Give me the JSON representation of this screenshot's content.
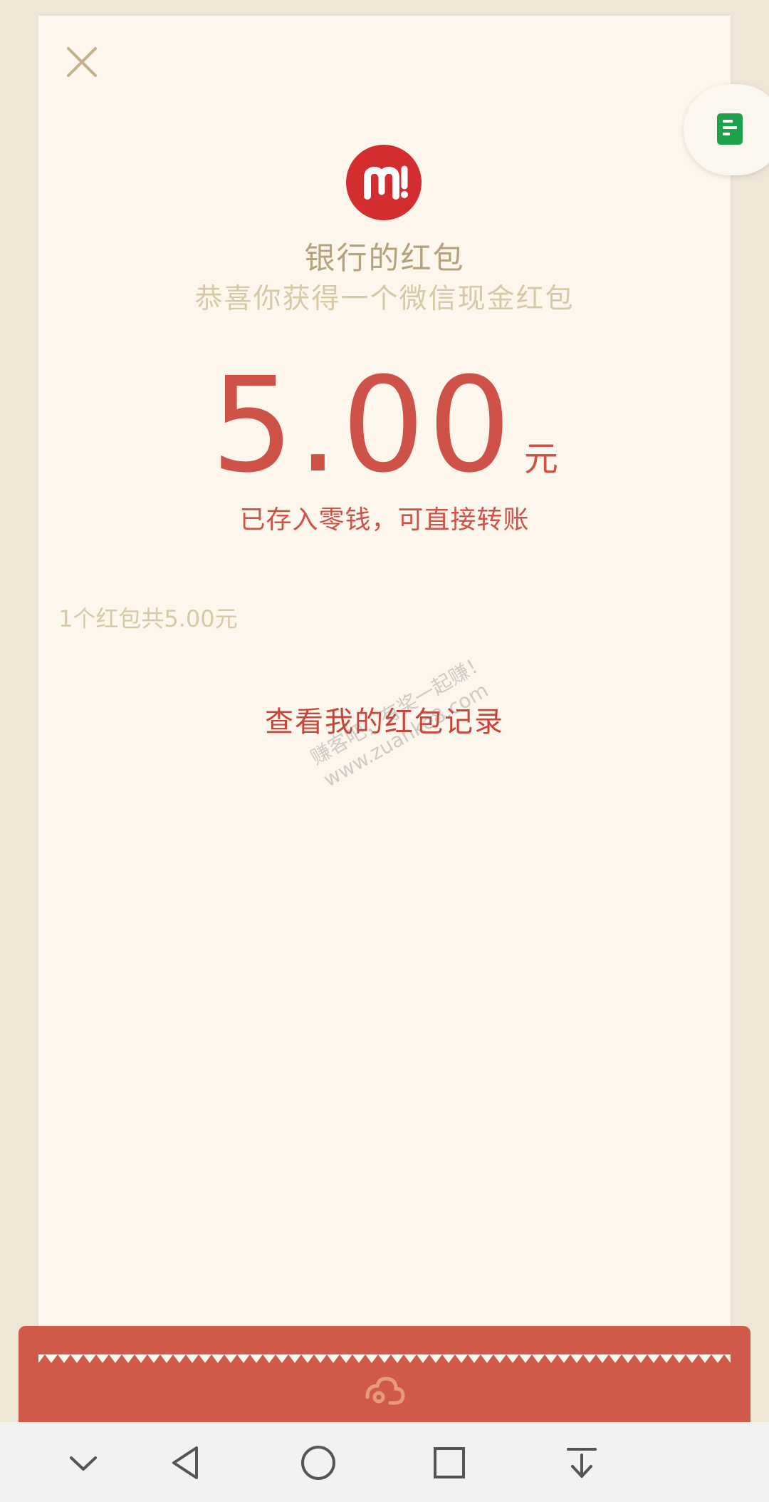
{
  "header": {
    "close_icon": "close-icon",
    "side_icon": "document-icon"
  },
  "sender": {
    "logo_icon": "bank-logo-icon",
    "name": "银行的红包",
    "greeting": "恭喜你获得一个微信现金红包"
  },
  "amount": {
    "value": "5.00",
    "unit": "元",
    "status": "已存入零钱，可直接转账"
  },
  "summary": "1个红包共5.00元",
  "record_link": "查看我的红包记录",
  "watermark": {
    "line1": "赚客吧，有奖一起赚！",
    "line2": "www.zuanke8.com"
  },
  "bottom_band_icon": "cloud-icon",
  "navbar": {
    "icons": [
      "chevron-down-icon",
      "back-icon",
      "home-icon",
      "recents-icon",
      "pull-down-icon"
    ]
  },
  "colors": {
    "accent_red": "#cf5248",
    "paper": "#fdf6ec",
    "background": "#efe6d6",
    "gold_text": "#b3a27b"
  }
}
